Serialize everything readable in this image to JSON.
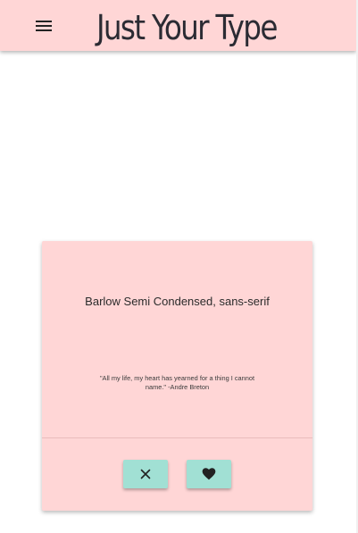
{
  "header": {
    "title": "Just Your Type",
    "menu_icon": "hamburger-menu-icon"
  },
  "card": {
    "font_name": "Barlow Semi Condensed, sans-serif",
    "quote": "\"All my life, my heart has yearned for a thing I cannot name.\" -Andre Breton",
    "reject_icon": "close-icon",
    "like_icon": "heart-icon"
  },
  "colors": {
    "header_background": "#ffd6d6",
    "card_background": "#ffd6d6",
    "button_background": "#a1e0d4",
    "icon_color": "#222222"
  }
}
